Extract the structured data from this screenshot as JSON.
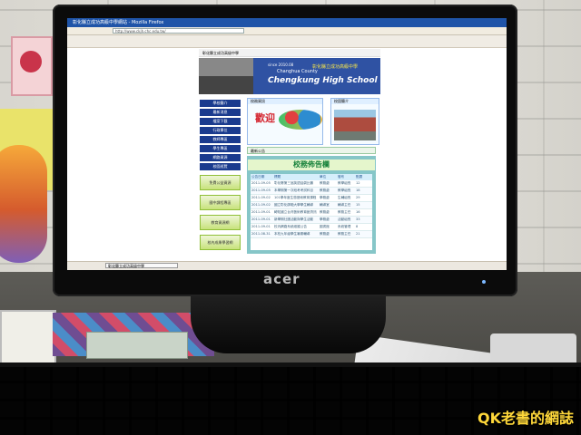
{
  "browser": {
    "title": "彰化縣立成功高級中學網站 - Mozilla Firefox",
    "address": "http://www.ckjh.chc.edu.tw/",
    "taskbar_item": "彰化縣立成功高級中學"
  },
  "website": {
    "top_title": "彰化縣立成功高級中學",
    "banner": {
      "since": "since 2010.08",
      "chinese_name": "彰化縣立成功高級中學",
      "county": "Changhua County",
      "school": "Chengkung High School"
    },
    "left_nav": [
      "學校簡介",
      "最新消息",
      "檔案下載",
      "行政單位",
      "教師專區",
      "學生專區",
      "網路資源",
      "校園巡覽"
    ],
    "left_buttons": [
      "免費公益資源",
      "國中課程專區",
      "教育資源網",
      "校內成果學習網"
    ],
    "news_box_header": "校務資訊",
    "welcome": "歡迎",
    "campus_box_header": "校園簡介",
    "section_header": "最新公告",
    "bulletin_title": "校務佈告欄",
    "table_headers": [
      "公告日期",
      "標題",
      "單位",
      "發布",
      "點閱"
    ],
    "rows": [
      [
        "2011-09-05",
        "彰化縣第三屆英語話劇比賽",
        "教務處",
        "教學組長",
        "12"
      ],
      [
        "2011-09-05",
        "本學期第一次段考考試科目",
        "教務處",
        "教學組長",
        "18"
      ],
      [
        "2011-09-02",
        "101學年度生態藝術教育課程",
        "學務處",
        "生輔組長",
        "29"
      ],
      [
        "2011-09-02",
        "國立彰化師範大學學生輔導",
        "輔導室",
        "輔導主任",
        "15"
      ],
      [
        "2011-09-01",
        "轉知國立台灣藝術教育館資訊",
        "教務處",
        "教務主任",
        "16"
      ],
      [
        "2011-09-01",
        "新學期社團活動與學生活動",
        "學務處",
        "活動組長",
        "33"
      ],
      [
        "2011-09-01",
        "校內網路系統維護公告",
        "圖書館",
        "系統管理",
        "8"
      ],
      [
        "2011-08-31",
        "本校九年級學生暑期輔導",
        "教務處",
        "教務主任",
        "21"
      ]
    ]
  },
  "device": {
    "brand": "acer"
  },
  "watermark": {
    "text": "QK老書的網誌"
  }
}
